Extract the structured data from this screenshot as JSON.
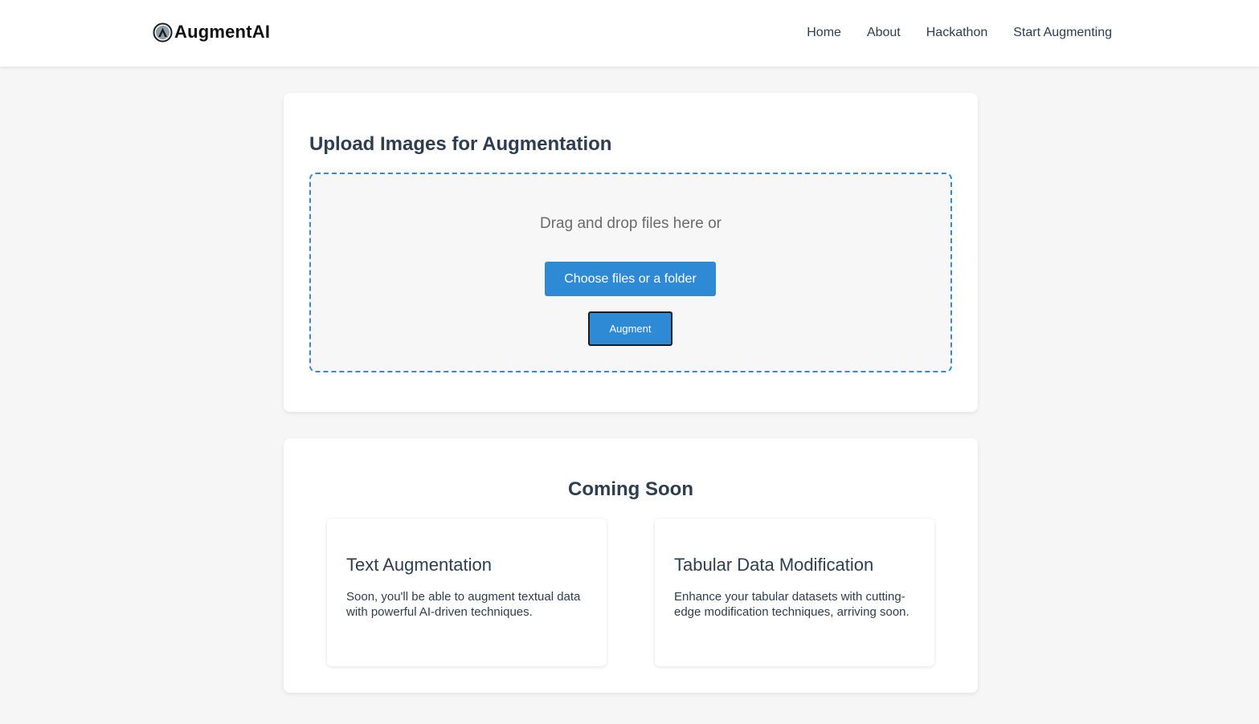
{
  "brand": {
    "name": "AugmentAI"
  },
  "nav": {
    "items": [
      {
        "label": "Home"
      },
      {
        "label": "About"
      },
      {
        "label": "Hackathon"
      },
      {
        "label": "Start Augmenting"
      }
    ]
  },
  "upload": {
    "title": "Upload Images for Augmentation",
    "drop_text": "Drag and drop files here or",
    "choose_label": "Choose files or a folder",
    "augment_label": "Augment"
  },
  "coming_soon": {
    "title": "Coming Soon",
    "features": [
      {
        "title": "Text Augmentation",
        "description": "Soon, you'll be able to augment textual data with powerful AI-driven techniques."
      },
      {
        "title": "Tabular Data Modification",
        "description": "Enhance your tabular datasets with cutting-edge modification techniques, arriving soon."
      }
    ]
  },
  "colors": {
    "accent": "#2f8ad6",
    "text": "#2c3e50",
    "background": "#f6f6f6"
  },
  "icons": {
    "logo": "augmentai-logo-icon"
  }
}
